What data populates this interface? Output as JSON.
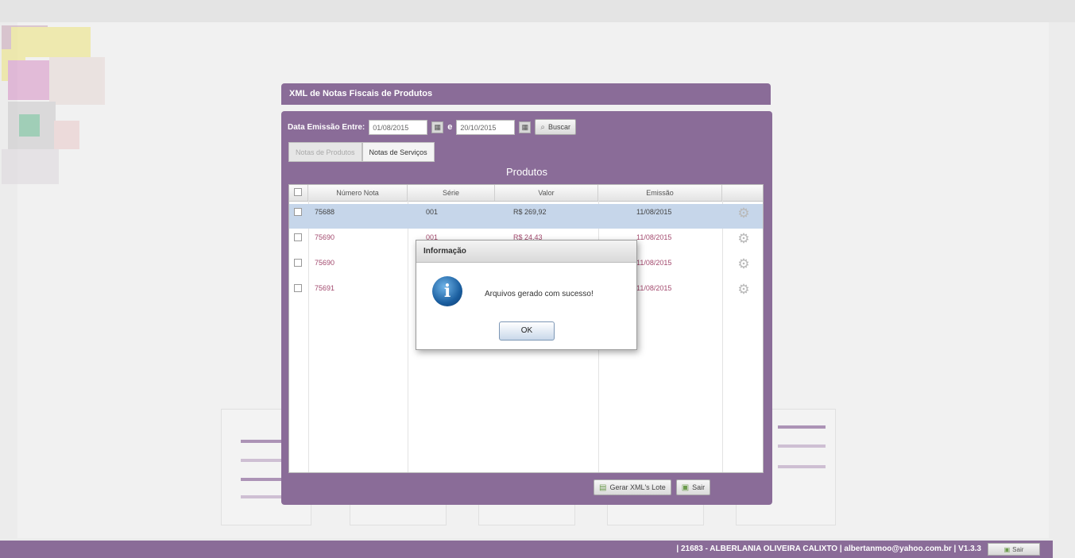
{
  "window": {
    "title": "XML de Notas Fiscais de Produtos"
  },
  "filter": {
    "label": "Data Emissão Entre:",
    "date_from": "01/08/2015",
    "separator": "e",
    "date_to": "20/10/2015",
    "search_label": "Buscar"
  },
  "tabs": [
    {
      "label": "Notas de Produtos",
      "active": false
    },
    {
      "label": "Notas de Serviços",
      "active": true
    }
  ],
  "section_title": "Produtos",
  "table": {
    "columns": [
      "Número Nota",
      "Série",
      "Valor",
      "Emissão"
    ],
    "rows": [
      {
        "numero": "75688",
        "serie": "001",
        "valor": "R$ 269,92",
        "emissao": "11/08/2015",
        "selected": true
      },
      {
        "numero": "75690",
        "serie": "001",
        "valor": "R$ 24,43",
        "emissao": "11/08/2015",
        "selected": false
      },
      {
        "numero": "75690",
        "serie": "",
        "valor": "",
        "emissao": "11/08/2015",
        "selected": false
      },
      {
        "numero": "75691",
        "serie": "",
        "valor": "",
        "emissao": "11/08/2015",
        "selected": false
      }
    ]
  },
  "actions": {
    "generate_label": "Gerar XML's Lote",
    "exit_label": "Sair"
  },
  "dialog": {
    "title": "Informação",
    "message": "Arquivos gerado com sucesso!",
    "ok_label": "OK"
  },
  "footer": {
    "text": "| 21683 - ALBERLANIA OLIVEIRA CALIXTO | albertanmoo@yahoo.com.br | V1.3.3",
    "button_label": "Sair"
  },
  "colors": {
    "accent": "#8a6c98",
    "selected_row": "#c6d6ea",
    "row_text": "#a34a6e"
  }
}
